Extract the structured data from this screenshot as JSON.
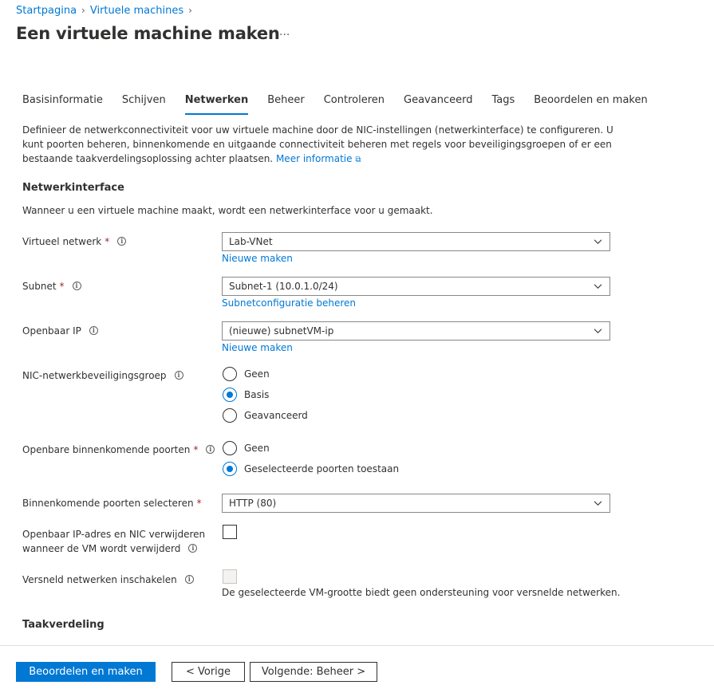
{
  "breadcrumb": {
    "items": [
      "Startpagina",
      "Virtuele machines"
    ]
  },
  "title": "Een virtuele machine maken",
  "title_more": "···",
  "tabs": [
    "Basisinformatie",
    "Schijven",
    "Netwerken",
    "Beheer",
    "Controleren",
    "Geavanceerd",
    "Tags",
    "Beoordelen en maken"
  ],
  "active_tab": "Netwerken",
  "intro": {
    "text": "Definieer de netwerkconnectiviteit voor uw virtuele machine door de NIC-instellingen (netwerkinterface) te configureren. U kunt poorten beheren, binnenkomende en uitgaande connectiviteit beheren met regels voor beveiligingsgroepen of er een bestaande taakverdelingsoplossing achter plaatsen.",
    "link": "Meer informatie"
  },
  "network_interface": {
    "title": "Netwerkinterface",
    "description": "Wanneer u een virtuele machine maakt, wordt een netwerkinterface voor u gemaakt.",
    "vnet": {
      "label": "Virtueel netwerk",
      "value": "Lab-VNet",
      "link": "Nieuwe maken"
    },
    "subnet": {
      "label": "Subnet",
      "value": "Subnet-1 (10.0.1.0/24)",
      "link": "Subnetconfiguratie beheren"
    },
    "public_ip": {
      "label": "Openbaar IP",
      "value": "(nieuwe) subnetVM-ip",
      "link": "Nieuwe maken"
    },
    "nsg": {
      "label": "NIC-netwerkbeveiligingsgroep",
      "options": [
        "Geen",
        "Basis",
        "Geavanceerd"
      ],
      "selected": "Basis"
    },
    "inbound_ports": {
      "label": "Openbare binnenkomende poorten",
      "options": [
        "Geen",
        "Geselecteerde poorten toestaan"
      ],
      "selected": "Geselecteerde poorten toestaan"
    },
    "select_ports": {
      "label": "Binnenkomende poorten selecteren",
      "value": "HTTP (80)"
    },
    "delete_ip_nic": {
      "label_line1": "Openbaar IP-adres en NIC verwijderen",
      "label_line2": "wanneer de VM wordt verwijderd",
      "checked": false
    },
    "accelerated": {
      "label": "Versneld netwerken inschakelen",
      "checked": false,
      "disabled": true,
      "hint": "De geselecteerde VM-grootte biedt geen ondersteuning voor versnelde netwerken."
    }
  },
  "load_balancing": {
    "title": "Taakverdeling"
  },
  "footer": {
    "review_create": "Beoordelen en maken",
    "previous": "< Vorige",
    "next": "Volgende: Beheer >"
  },
  "colors": {
    "accent": "#0078d4",
    "required": "#a4262c",
    "text": "#323130"
  }
}
